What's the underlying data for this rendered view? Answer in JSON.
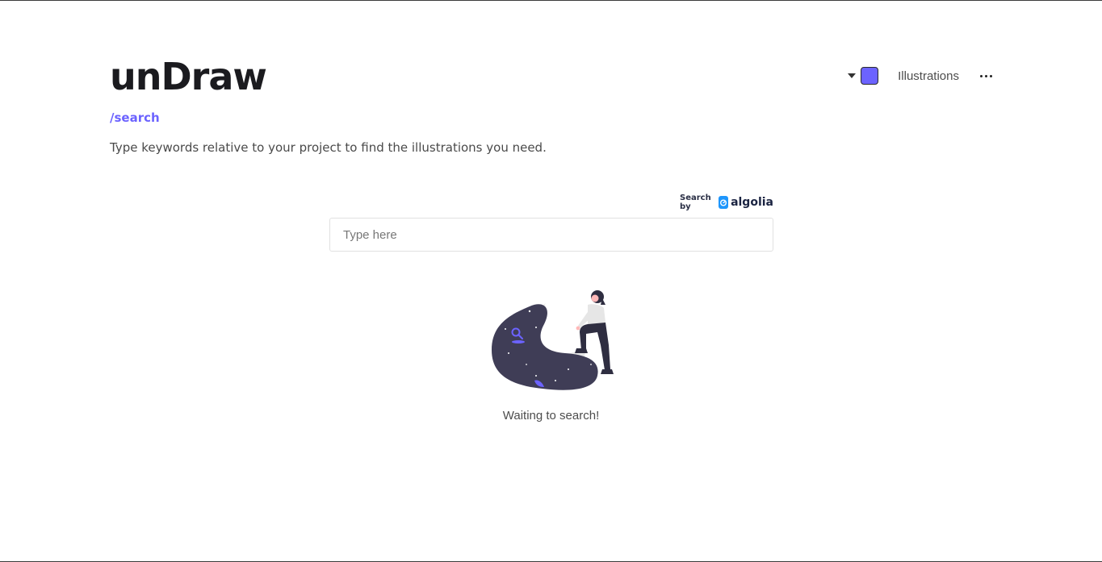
{
  "header": {
    "brand": "unDraw",
    "route": "/search",
    "subtitle": "Type keywords relative to your project to find the illustrations you need."
  },
  "nav": {
    "color_picker_color": "#6c63ff",
    "illustrations_label": "Illustrations",
    "more_icon": "more-horizontal-icon"
  },
  "search": {
    "powered_by_label": "Search by",
    "provider_name": "algolia",
    "placeholder": "Type here",
    "value": ""
  },
  "empty_state": {
    "message": "Waiting to search!"
  },
  "colors": {
    "accent": "#6c63ff",
    "blob": "#3f3d56",
    "algolia_blue": "#1e96fc"
  }
}
